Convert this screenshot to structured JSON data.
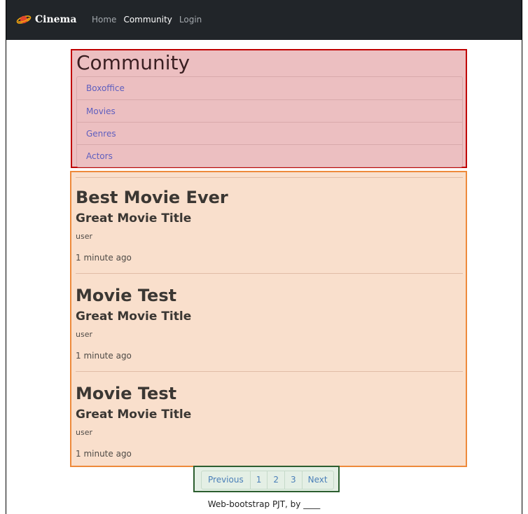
{
  "navbar": {
    "brand": "Cinema",
    "brand_icon": "saturn-planet-icon",
    "links": [
      {
        "label": "Home",
        "active": false
      },
      {
        "label": "Community",
        "active": true
      },
      {
        "label": "Login",
        "active": false
      }
    ]
  },
  "community": {
    "title": "Community",
    "items": [
      "Boxoffice",
      "Movies",
      "Genres",
      "Actors"
    ]
  },
  "posts": [
    {
      "title": "Best Movie Ever",
      "movie": "Great Movie Title",
      "user": "user",
      "time": "1 minute ago"
    },
    {
      "title": "Movie Test",
      "movie": "Great Movie Title",
      "user": "user",
      "time": "1 minute ago"
    },
    {
      "title": "Movie Test",
      "movie": "Great Movie Title",
      "user": "user",
      "time": "1 minute ago"
    }
  ],
  "pagination": {
    "previous": "Previous",
    "pages": [
      "1",
      "2",
      "3"
    ],
    "next": "Next"
  },
  "footer": {
    "text": "Web-bootstrap PJT, by ____"
  },
  "colors": {
    "navbar_bg": "#212529",
    "community_highlight": "#c00000",
    "posts_highlight": "#ee8a3b",
    "pagination_highlight": "#2c5e2f",
    "link": "#5f5fbf"
  }
}
